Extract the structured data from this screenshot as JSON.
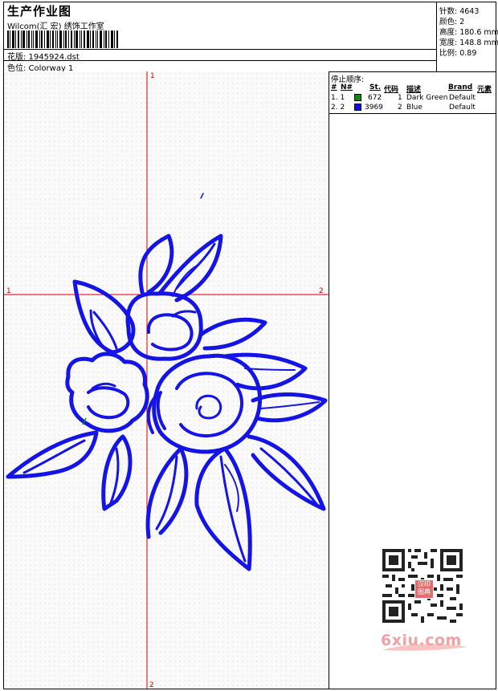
{
  "header": {
    "title": "生产作业图",
    "studio": "Wilcom(汇 宏) 绣饰工作室",
    "design_label": "花版: 1945924.dst",
    "colorway_label": "色位: Colorway 1"
  },
  "stats": [
    {
      "label": "针数: 4643"
    },
    {
      "label": "颜色: 2"
    },
    {
      "label": "高度: 180.6 mm"
    },
    {
      "label": "宽度: 148.8 mm"
    },
    {
      "label": "比例: 0.89"
    }
  ],
  "axes": {
    "top": "1",
    "bottom": "2",
    "left": "1",
    "right": "2"
  },
  "stop_sequence": {
    "title": "停止顺序:",
    "headers": {
      "hash": "#",
      "n": "N#",
      "st": "St.",
      "code": "代码",
      "desc": "描述",
      "brand": "Brand",
      "element": "元素"
    },
    "rows": [
      {
        "idx": "1. 1",
        "color": "#0b8a0b",
        "st": "672",
        "code": "1",
        "desc": "Dark Green",
        "brand": "Default"
      },
      {
        "idx": "2. 2",
        "color": "#1010e0",
        "st": "3969",
        "code": "2",
        "desc": "Blue",
        "brand": "Default"
      }
    ]
  },
  "watermark": {
    "text": "6xiu.com",
    "seal": "汉印图典"
  },
  "colors": {
    "stitch_blue": "#1414e6",
    "stitch_green": "#0b8a0b",
    "axis_red": "#e00000"
  },
  "icons": [
    "barcode-icon",
    "qr-code-icon"
  ]
}
